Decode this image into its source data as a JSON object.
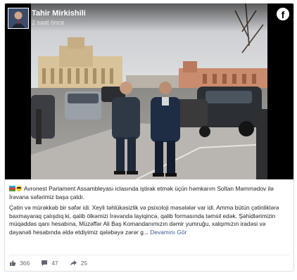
{
  "post": {
    "author": "Tahir Mirkishili",
    "time": "2 saat önce",
    "paragraphs": {
      "p1": "Avronest Parlament Assambleyası iclasında iştirak etmək üçün həmkarım Soltan Məmmədov ilə İrəvana səfərimiz başa çatdı.",
      "p2": "Çətin və mürəkkəb bir səfər idi. Xeyli təhlükəsizlik və psixoloji məsələlər var idi. Amma bütün çətinliklərə baxmayaraq çalışdıq ki, qalib ölkəmizi İrəvanda layiqincə, qalib formasında təmsil edək. Şəhidlərimizin müqəddəs qanı hesabına, Müzəffər Ali Baş Komandanımızın dəmir yumruğu, xalqımızın iradəsi və dəyanəti hesabında əldə etdiyimiz qələbəyə zərər g...",
      "more": "Devamını Gör"
    }
  },
  "icons": {
    "brand": "facebook-icon",
    "flag": "azerbaijan-flag-icon",
    "emoji": "smiling-face-sunglasses-icon"
  },
  "reactions": {
    "likes": "366",
    "comments": "47",
    "shares": "25"
  },
  "colors": {
    "link": "#385898",
    "muted": "#606770",
    "border": "#dddfe2"
  }
}
